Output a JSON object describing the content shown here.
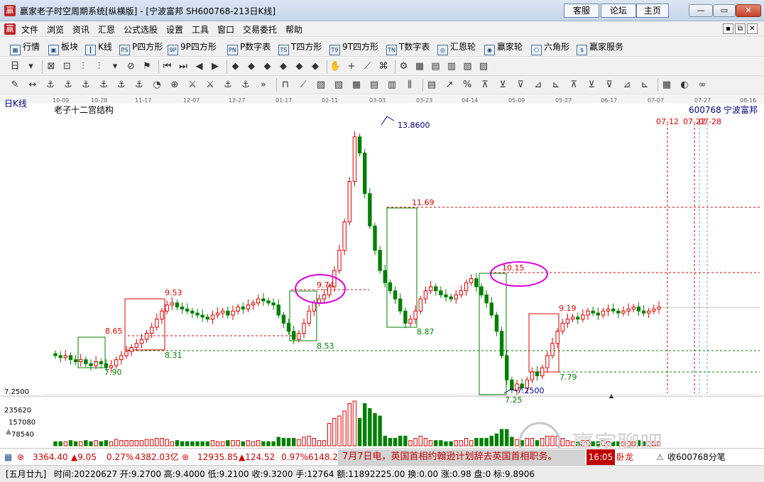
{
  "window": {
    "app_icon": "赢",
    "title": "赢家老子时空周期系统[纵横版] - [宁波富邦  SH600768-213日K线]",
    "links": [
      "客服",
      "论坛",
      "主页"
    ],
    "minimize": "—",
    "restore": "▭",
    "close": "✕"
  },
  "menu": {
    "icon": "赢",
    "items": [
      "文件",
      "浏览",
      "资讯",
      "汇恩",
      "公式选股",
      "设置",
      "工具",
      "窗口",
      "交易委托",
      "帮助"
    ],
    "mdi_buttons": [
      "▪",
      "⧉",
      "✕"
    ]
  },
  "toolbar1": {
    "items": [
      {
        "label": "行情",
        "icon": "grid-icon",
        "glyph": "▦"
      },
      {
        "label": "板块",
        "icon": "blocks-icon",
        "glyph": "▣"
      },
      {
        "label": "K线",
        "icon": "candles-icon",
        "glyph": "┃"
      },
      {
        "label": "P四方形",
        "icon": "ps-icon",
        "glyph": "PS"
      },
      {
        "label": "9P四方形",
        "icon": "9p-icon",
        "glyph": "9P"
      },
      {
        "label": "P数字表",
        "icon": "pn-icon",
        "glyph": "PN"
      },
      {
        "label": "T四方形",
        "icon": "ts-icon",
        "glyph": "TS"
      },
      {
        "label": "9T四方形",
        "icon": "9t-icon",
        "glyph": "T9"
      },
      {
        "label": "T数字表",
        "icon": "tn-icon",
        "glyph": "TN"
      },
      {
        "label": "汇恩轮",
        "icon": "wheel-icon",
        "glyph": "◎"
      },
      {
        "label": "赢家轮",
        "icon": "winner-wheel-icon",
        "glyph": "◉"
      },
      {
        "label": "六角形",
        "icon": "hexagon-icon",
        "glyph": "⬡"
      },
      {
        "label": "赢家服务",
        "icon": "dollar-icon",
        "glyph": "$"
      }
    ]
  },
  "toolbar2_icons": [
    "日",
    "▾",
    "⊠",
    "⊡",
    "⫶",
    "⫶",
    "▾",
    "⊘",
    "⚑",
    "⏮",
    "⏭",
    "◀",
    "▶",
    "◆",
    "◆",
    "◆",
    "◆",
    "◆",
    "◆",
    "✋",
    "+",
    "⟋",
    "⌘",
    "⚙",
    "▦",
    "▤",
    "▥",
    "▧",
    "▨"
  ],
  "toolbar3_icons": [
    "✎",
    "↔",
    "⚓",
    "⚓",
    "⚓",
    "⚓",
    "⚓",
    "⚓",
    "◔",
    "⊕",
    "⚔",
    "⚔",
    "⚓",
    "⚓",
    "»",
    "⊓",
    "⟋",
    "▨",
    "▧",
    "▦",
    "▤",
    "▥",
    "⫼",
    "▤",
    "↗",
    "%",
    "⊼",
    "⊻",
    "⊽",
    "⊿",
    "⊾",
    "⊼",
    "⊻",
    "⊽",
    "⊿",
    "⊾",
    "▦",
    "◐",
    "∞"
  ],
  "chart": {
    "period_label": "日K线",
    "indicator_name": "老子十二宫结构",
    "code": "600768",
    "stock_name": "宁波富邦",
    "date_ticks": [
      "10-09",
      "10-28",
      "11-17",
      "12-07",
      "12-27",
      "01-17",
      "02-11",
      "03-03",
      "03-23",
      "04-14",
      "05-09",
      "05-27",
      "06-17",
      "07-07",
      "07-27",
      "08-16"
    ],
    "future_dates": [
      "07-12",
      "07-22",
      "07-28"
    ],
    "price_labels": [
      "13.8600",
      "11.69",
      "10.15",
      "9.74",
      "9.53",
      "9.19",
      "8.87",
      "8.65",
      "8.53",
      "8.31",
      "7.90",
      "7.79",
      "7.25",
      "7.2500"
    ],
    "y_axis_price": "7.2500",
    "volume_ticks": [
      "235620",
      "157080",
      "78540"
    ],
    "colors": {
      "up": "#e00000",
      "down": "#008000",
      "ellipse": "#e000e0",
      "level_red": "#e00000",
      "level_green": "#008000",
      "label_blue": "#000099"
    }
  },
  "chart_data": {
    "type": "bar",
    "title": "老子十二宫结构",
    "x_ticks": [
      "10-09",
      "10-28",
      "11-17",
      "12-07",
      "12-27",
      "01-17",
      "02-11",
      "03-03",
      "03-23",
      "04-14",
      "05-09",
      "05-27",
      "06-17",
      "07-07",
      "07-27",
      "08-16"
    ],
    "annotated_prices": [
      13.86,
      11.69,
      10.15,
      9.74,
      9.53,
      9.19,
      8.87,
      8.65,
      8.53,
      8.31,
      7.9,
      7.79,
      7.25
    ],
    "ohlc_closes": [
      8.2,
      8.15,
      8.2,
      8.1,
      8.05,
      8.1,
      8.0,
      7.95,
      8.05,
      8.0,
      7.9,
      7.95,
      8.1,
      8.2,
      8.3,
      8.4,
      8.5,
      8.6,
      8.75,
      8.9,
      9.1,
      9.3,
      9.45,
      9.5,
      9.4,
      9.35,
      9.3,
      9.25,
      9.2,
      9.15,
      9.1,
      9.2,
      9.25,
      9.3,
      9.2,
      9.3,
      9.4,
      9.35,
      9.45,
      9.5,
      9.6,
      9.55,
      9.5,
      9.45,
      9.2,
      9.0,
      8.8,
      8.6,
      8.75,
      9.0,
      9.3,
      9.5,
      9.6,
      9.7,
      9.9,
      10.3,
      10.8,
      11.5,
      12.5,
      13.6,
      13.2,
      12.2,
      11.4,
      10.8,
      10.3,
      10.0,
      9.8,
      9.6,
      9.3,
      9.0,
      9.1,
      9.3,
      9.6,
      9.8,
      9.9,
      9.8,
      9.7,
      9.65,
      9.6,
      9.7,
      9.8,
      10.0,
      10.1,
      9.9,
      9.7,
      9.5,
      9.2,
      8.8,
      8.2,
      7.6,
      7.35,
      7.5,
      7.4,
      7.6,
      7.8,
      7.7,
      7.9,
      8.2,
      8.5,
      8.8,
      9.0,
      9.1,
      9.15,
      9.1,
      9.2,
      9.3,
      9.25,
      9.2,
      9.3,
      9.35,
      9.3,
      9.25,
      9.3,
      9.35,
      9.4,
      9.3,
      9.25,
      9.3,
      9.35,
      9.4
    ],
    "volume_axis": [
      235620,
      157080,
      78540
    ],
    "y_axis_min_label": 7.25
  },
  "status1": {
    "index1_value": "3364.40",
    "index1_change": "▲9.05",
    "index1_pct": "0.27%",
    "index1_amount": "4382.03亿",
    "index2_value": "12935.85",
    "index2_change": "▲124.52",
    "index2_pct": "0.97%",
    "index2_amount": "6148.24",
    "news": "7月7日电，英国首相约翰逊计划辞去英国首相职务。",
    "time": "16:05",
    "tail": "卧龙",
    "alert_text": "收600768分笔"
  },
  "status2": {
    "lunar": "[五月廿九]",
    "fields": "时间:20220627 开:9.2700 高:9.4000 低:9.2100 收:9.3200 手:12764 额:11892225.00 换:0.00 涨:0.98 盘:0 标:9.8906"
  },
  "watermark": {
    "text": "赢家聊吧",
    "url": "liaoba.yjcf360.com"
  }
}
